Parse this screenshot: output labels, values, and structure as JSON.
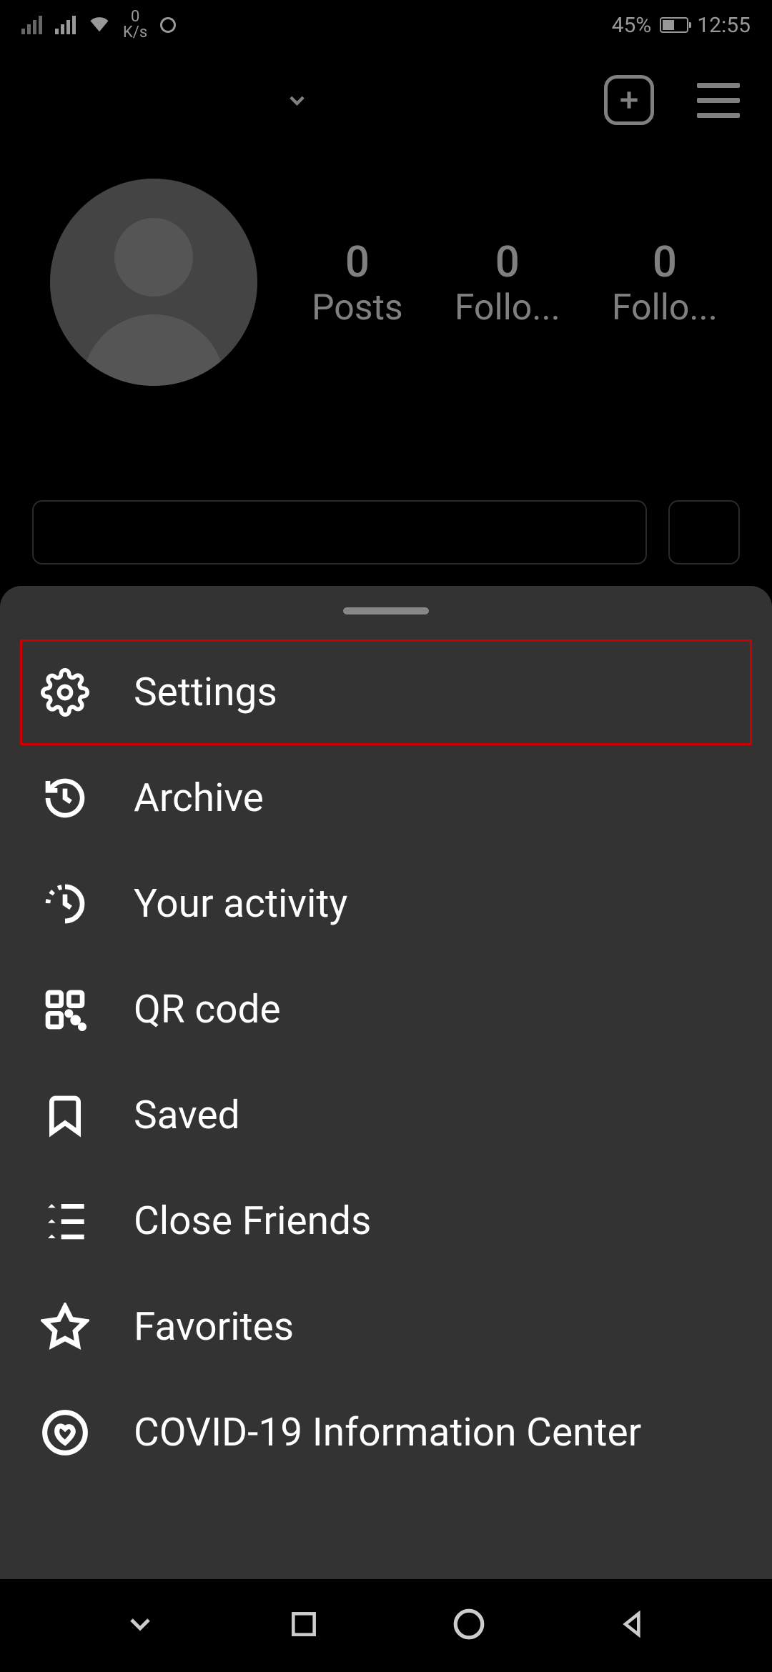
{
  "statusBar": {
    "netSpeedTop": "0",
    "netSpeedBottom": "K/s",
    "battery": "45%",
    "time": "12:55"
  },
  "profile": {
    "stats": {
      "posts": {
        "value": "0",
        "label": "Posts"
      },
      "followers": {
        "value": "0",
        "label": "Follo..."
      },
      "following": {
        "value": "0",
        "label": "Follo..."
      }
    }
  },
  "menu": {
    "settings": "Settings",
    "archive": "Archive",
    "activity": "Your activity",
    "qrcode": "QR code",
    "saved": "Saved",
    "closeFriends": "Close Friends",
    "favorites": "Favorites",
    "covid": "COVID-19 Information Center"
  }
}
